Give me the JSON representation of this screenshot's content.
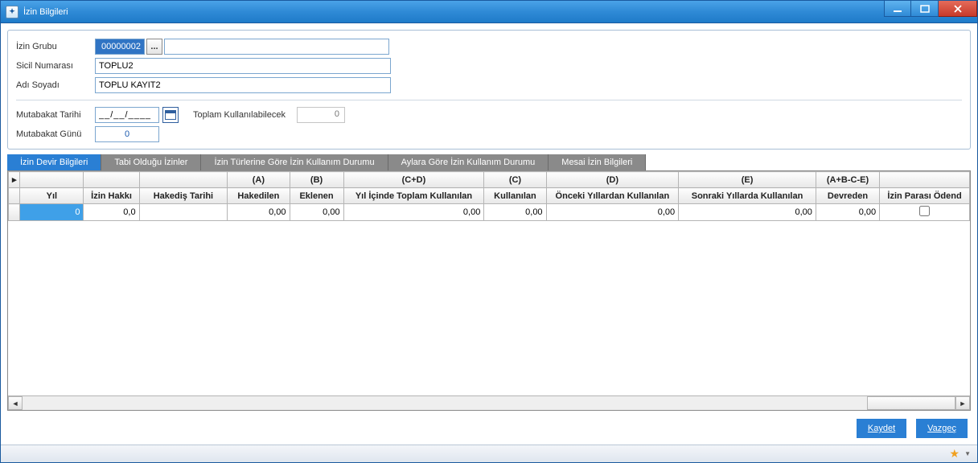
{
  "window": {
    "title": "İzin Bilgileri"
  },
  "form": {
    "izin_grubu_label": "İzin Grubu",
    "izin_grubu_value": "00000002",
    "lookup_label": "...",
    "izin_grubu_desc": "",
    "sicil_label": "Sicil Numarası",
    "sicil_value": "TOPLU2",
    "adi_label": "Adı Soyadı",
    "adi_value": "TOPLU KAYIT2",
    "mutabakat_tarihi_label": "Mutabakat Tarihi",
    "mutabakat_tarihi_value": "__/__/____",
    "toplam_label": "Toplam Kullanılabilecek",
    "toplam_value": "0",
    "mutabakat_gunu_label": "Mutabakat Günü",
    "mutabakat_gunu_value": "0"
  },
  "tabs": [
    "İzin Devir Bilgileri",
    "Tabi Olduğu İzinler",
    "İzin Türlerine Göre İzin Kullanım Durumu",
    "Aylara Göre İzin Kullanım Durumu",
    "Mesai İzin Bilgileri"
  ],
  "grid": {
    "group_headers": [
      "",
      "",
      "",
      "(A)",
      "(B)",
      "(C+D)",
      "(C)",
      "(D)",
      "(E)",
      "(A+B-C-E)",
      ""
    ],
    "headers": [
      "Yıl",
      "İzin Hakkı",
      "Hakediş Tarihi",
      "Hakedilen",
      "Eklenen",
      "Yıl İçinde Toplam Kullanılan",
      "Kullanılan",
      "Önceki Yıllardan Kullanılan",
      "Sonraki Yıllarda Kullanılan",
      "Devreden",
      "İzin Parası Ödend"
    ],
    "row": {
      "yil": "0",
      "izin_hakki": "0,0",
      "hakedis_tarihi": "",
      "hakedilen": "0,00",
      "eklenen": "0,00",
      "yil_toplam": "0,00",
      "kullanilan": "0,00",
      "onceki": "0,00",
      "sonraki": "0,00",
      "devreden": "0,00"
    }
  },
  "buttons": {
    "save": "Kaydet",
    "cancel": "Vazgeç"
  }
}
